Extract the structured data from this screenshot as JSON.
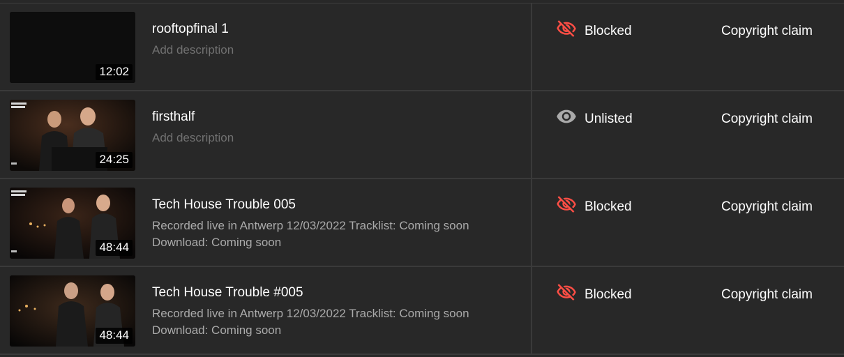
{
  "videos": [
    {
      "title": "rooftopfinal 1",
      "description": "Add description",
      "description_is_placeholder": true,
      "duration": "12:02",
      "visibility": "Blocked",
      "visibility_icon": "eye-off-icon",
      "visibility_color": "#ff4e45",
      "restrictions": "Copyright claim"
    },
    {
      "title": "firsthalf",
      "description": "Add description",
      "description_is_placeholder": true,
      "duration": "24:25",
      "visibility": "Unlisted",
      "visibility_icon": "eye-icon",
      "visibility_color": "#aaaaaa",
      "restrictions": "Copyright claim"
    },
    {
      "title": "Tech House Trouble 005",
      "description": "Recorded live in Antwerp 12/03/2022 Tracklist: Coming soon Download: Coming soon",
      "description_is_placeholder": false,
      "duration": "48:44",
      "visibility": "Blocked",
      "visibility_icon": "eye-off-icon",
      "visibility_color": "#ff4e45",
      "restrictions": "Copyright claim"
    },
    {
      "title": "Tech House Trouble #005",
      "description": "Recorded live in Antwerp 12/03/2022 Tracklist: Coming soon Download: Coming soon",
      "description_is_placeholder": false,
      "duration": "48:44",
      "visibility": "Blocked",
      "visibility_icon": "eye-off-icon",
      "visibility_color": "#ff4e45",
      "restrictions": "Copyright claim"
    }
  ]
}
